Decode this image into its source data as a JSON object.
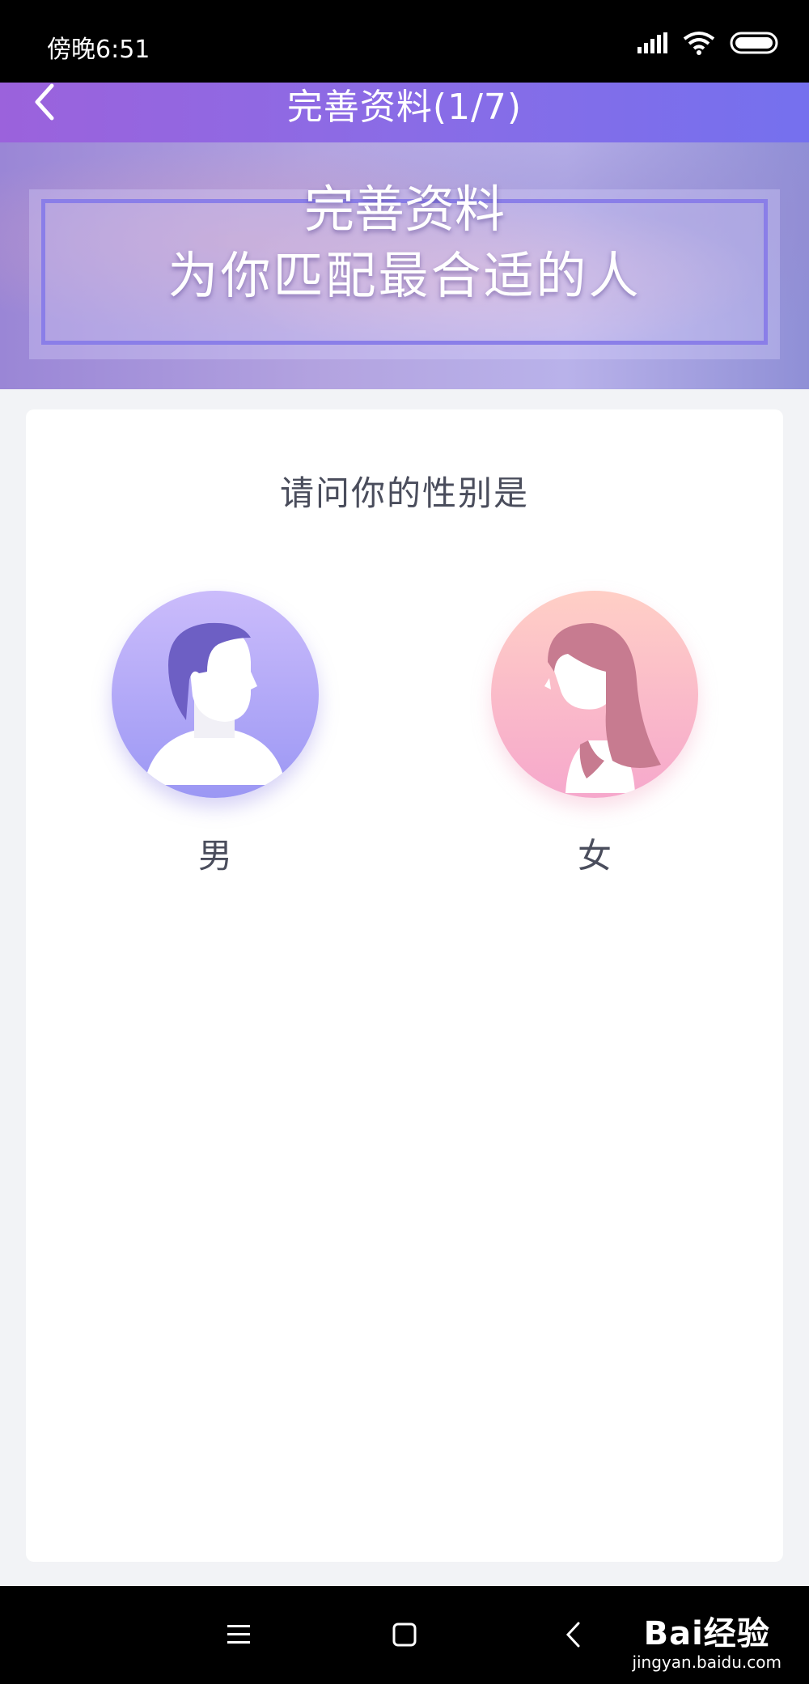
{
  "status_bar": {
    "time": "傍晚6:51"
  },
  "header": {
    "title": "完善资料(1/7)",
    "back_icon": "chevron-left-icon"
  },
  "banner": {
    "title": "完善资料",
    "subtitle": "为你匹配最合适的人"
  },
  "form": {
    "question": "请问你的性别是",
    "options": [
      {
        "label": "男",
        "avatar_icon": "male-avatar-icon"
      },
      {
        "label": "女",
        "avatar_icon": "female-avatar-icon"
      }
    ]
  },
  "nav_bar": {
    "icons": [
      "menu-icon",
      "home-icon",
      "back-icon"
    ]
  },
  "watermark": {
    "brand": "Bai经验",
    "url": "jingyan.baidu.com"
  },
  "colors": {
    "header_gradient_start": "#9b62dc",
    "header_gradient_end": "#7570ee",
    "male_avatar": "#9b97f4",
    "female_avatar": "#f6a8cc",
    "text": "#4a4d5c"
  }
}
